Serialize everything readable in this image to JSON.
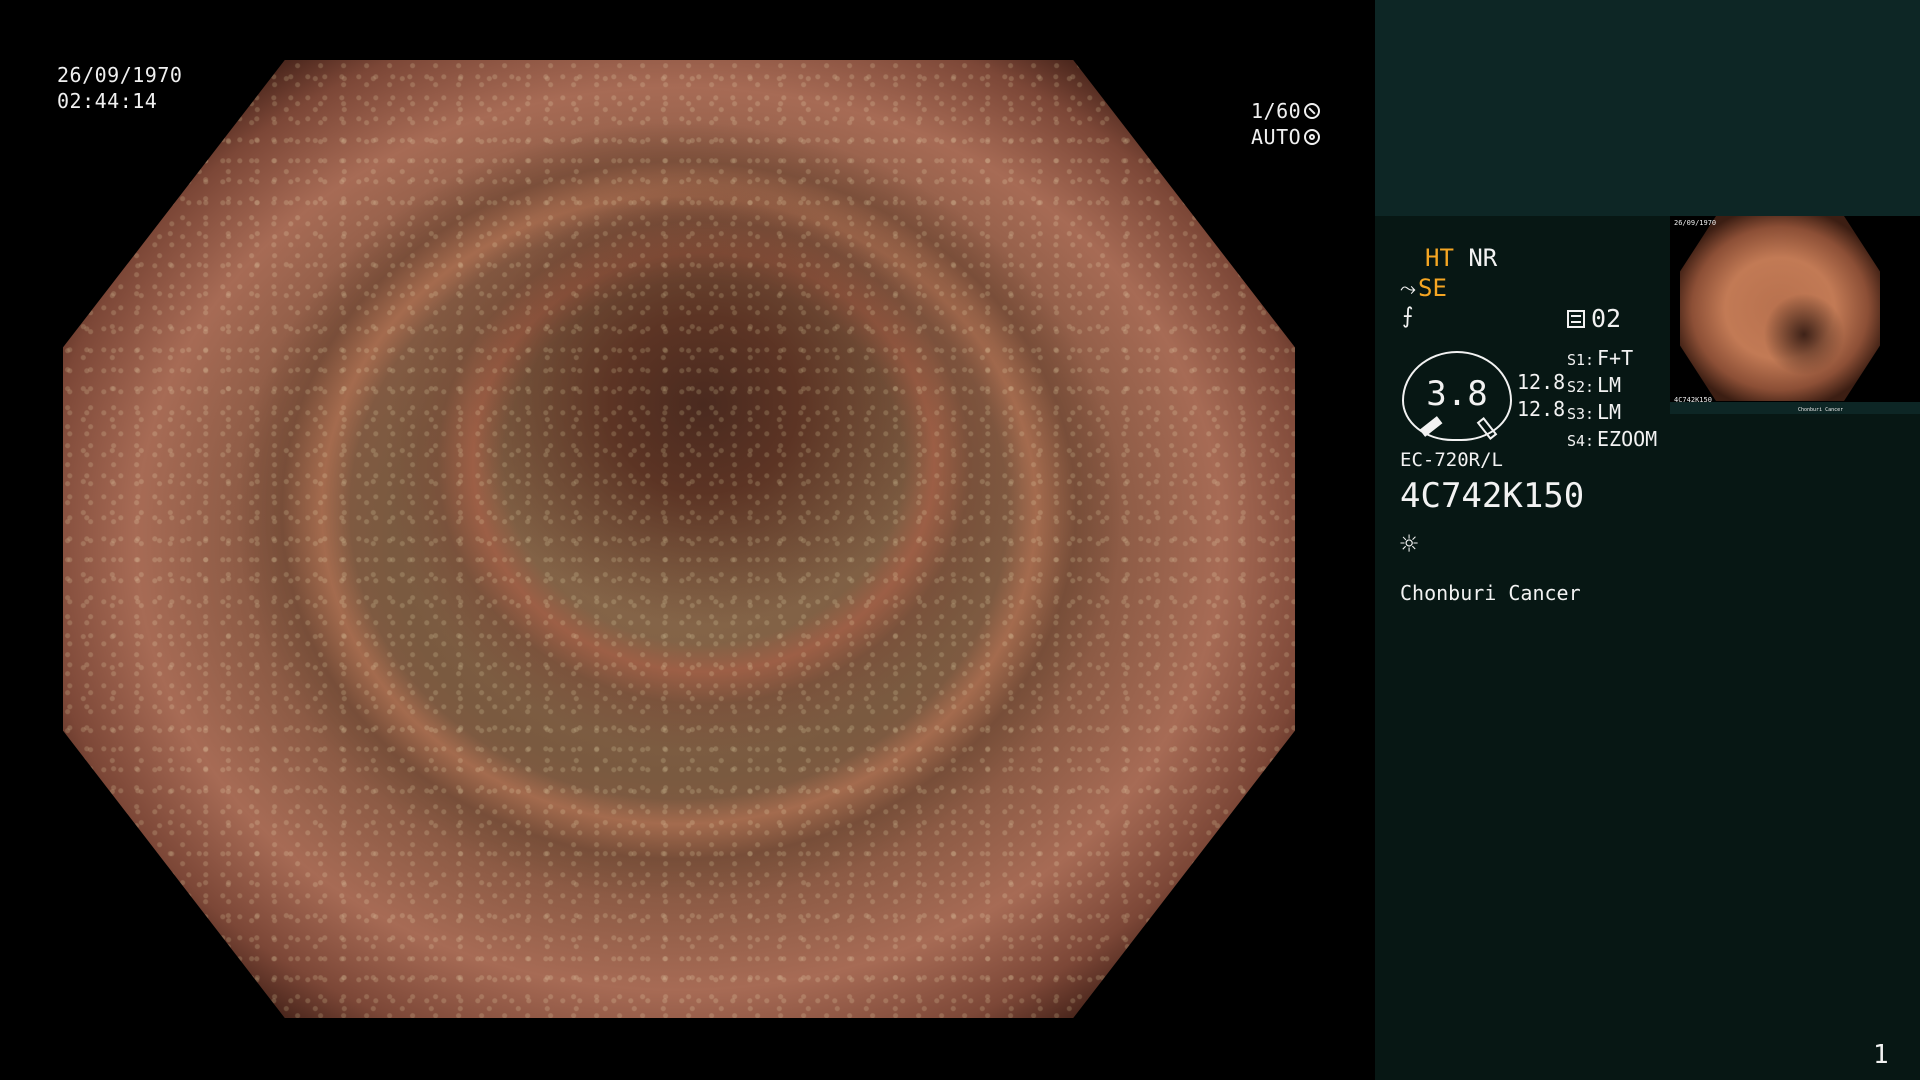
{
  "view": {
    "date": "26/09/1970",
    "time": "02:44:14",
    "shutter": "1/60",
    "iris": "AUTO"
  },
  "panel": {
    "ht": "HT",
    "nr": "NR",
    "se": "SE",
    "gauge_value": "3.8",
    "gauge_left": "12.8",
    "gauge_right": "12.8",
    "scope_count": "02",
    "scope_settings": [
      {
        "key": "S1:",
        "value": "F+T"
      },
      {
        "key": "S2:",
        "value": "LM"
      },
      {
        "key": "S3:",
        "value": "LM"
      },
      {
        "key": "S4:",
        "value": "EZOOM"
      }
    ],
    "model": "EC-720R/L",
    "serial": "4C742K150",
    "hospital": "Chonburi Cancer",
    "page_number": "1"
  },
  "thumbnail": {
    "date": "26/09/1970",
    "serial": "4C742K150",
    "hospital": "Chonburi Cancer"
  },
  "colors": {
    "panel_bg": "#071714",
    "panel_top_bg": "#0d2625",
    "accent": "#f5a623"
  },
  "icons": {
    "shutter": "shutter-icon",
    "iris": "iris-icon",
    "se": "structure-enhance-icon",
    "sharpness": "sharpness-icon",
    "recording": "film-icon",
    "light": "sun-icon"
  }
}
